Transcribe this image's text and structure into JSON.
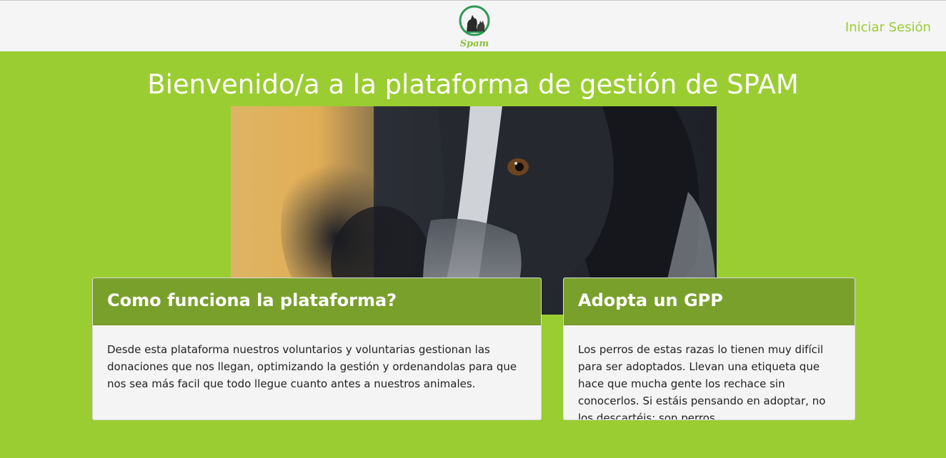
{
  "nav": {
    "logo_text": "Spam",
    "login_label": "Iniciar Sesión"
  },
  "hero": {
    "title": "Bienvenido/a a la plataforma de gestión de SPAM"
  },
  "cards": [
    {
      "title": "Como funciona la plataforma?",
      "body": "Desde esta plataforma nuestros voluntarios y voluntarias gestionan las donaciones que nos llegan, optimizando la gestión y ordenandolas para que nos sea más facil que todo llegue cuanto antes a nuestros animales."
    },
    {
      "title": "Adopta un GPP",
      "body": "Los perros de estas razas lo tienen muy difícil para ser adoptados. Llevan una etiqueta que hace que mucha gente los rechace sin conocerlos. Si estáis pensando en adoptar, no los descartéis: son perros"
    }
  ],
  "colors": {
    "brand_green": "#9acd32",
    "card_header": "#7aa02c",
    "navbar_bg": "#f5f5f5"
  }
}
